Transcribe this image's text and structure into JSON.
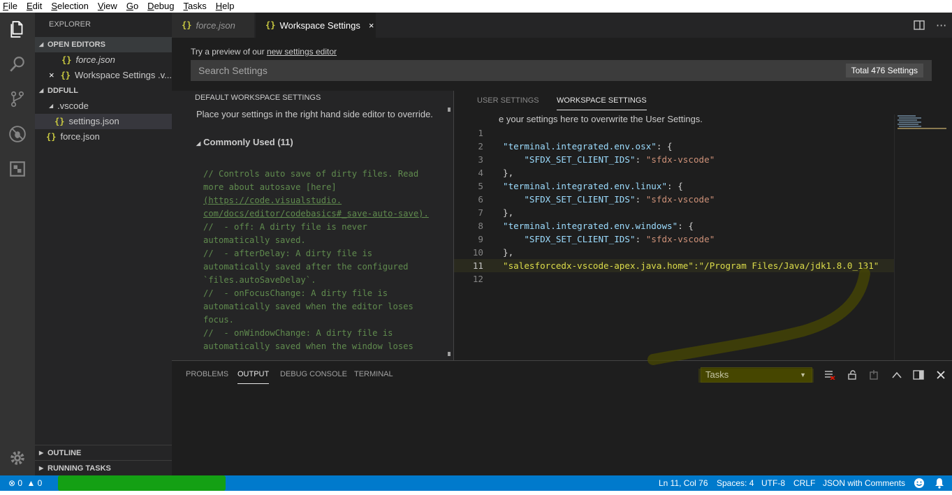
{
  "menu": [
    "File",
    "Edit",
    "Selection",
    "View",
    "Go",
    "Debug",
    "Tasks",
    "Help"
  ],
  "activity": [
    "explorer-icon",
    "search-icon",
    "source-control-icon",
    "debug-icon",
    "extensions-icon",
    "gear-icon"
  ],
  "sidebar": {
    "title": "EXPLORER",
    "open_editors_label": "OPEN EDITORS",
    "open_editors": [
      {
        "name": "force.json",
        "close": ""
      },
      {
        "name": "Workspace Settings .v...",
        "close": "×"
      }
    ],
    "project_label": "DDFULL",
    "folder": ".vscode",
    "settings_file": "settings.json",
    "root_file": "force.json",
    "outline_label": "OUTLINE",
    "running_tasks_label": "RUNNING TASKS"
  },
  "tabs": [
    {
      "label": "force.json",
      "active": false
    },
    {
      "label": "Workspace Settings",
      "active": true,
      "close": "×"
    }
  ],
  "tab_actions": {
    "split": "split-editor-icon",
    "more": "···"
  },
  "settings": {
    "preview_prefix": "Try a preview of our ",
    "preview_link": "new settings editor",
    "search_placeholder": "Search Settings",
    "count": "Total 476 Settings"
  },
  "default_pane": {
    "title": "DEFAULT WORKSPACE SETTINGS",
    "description": "Place your settings in the right hand side editor to override.",
    "group": "Commonly Used (11)",
    "comments": [
      "// Controls auto save of dirty files. Read",
      "more about autosave [here]",
      "(https://code.visualstudio.",
      "com/docs/editor/codebasics#_save-auto-save).",
      "//  - off: A dirty file is never",
      "automatically saved.",
      "//  - afterDelay: A dirty file is",
      "automatically saved after the configured",
      "`files.autoSaveDelay`.",
      "//  - onFocusChange: A dirty file is",
      "automatically saved when the editor loses",
      "focus.",
      "//  - onWindowChange: A dirty file is",
      "automatically saved when the window loses"
    ]
  },
  "workspace_pane": {
    "user_tab": "USER SETTINGS",
    "workspace_tab": "WORKSPACE SETTINGS",
    "description": "e your settings here to overwrite the User Settings.",
    "lines": [
      {
        "n": "1",
        "key": "",
        "rest": ""
      },
      {
        "n": "2",
        "key": "\"terminal.integrated.env.osx\"",
        "rest": ": {"
      },
      {
        "n": "3",
        "key": "    \"SFDX_SET_CLIENT_IDS\"",
        "rest": ": ",
        "val": "\"sfdx-vscode\""
      },
      {
        "n": "4",
        "key": "",
        "rest": "},"
      },
      {
        "n": "5",
        "key": "\"terminal.integrated.env.linux\"",
        "rest": ": {"
      },
      {
        "n": "6",
        "key": "    \"SFDX_SET_CLIENT_IDS\"",
        "rest": ": ",
        "val": "\"sfdx-vscode\""
      },
      {
        "n": "7",
        "key": "",
        "rest": "},"
      },
      {
        "n": "8",
        "key": "\"terminal.integrated.env.windows\"",
        "rest": ": {"
      },
      {
        "n": "9",
        "key": "    \"SFDX_SET_CLIENT_IDS\"",
        "rest": ": ",
        "val": "\"sfdx-vscode\""
      },
      {
        "n": "10",
        "key": "",
        "rest": "},"
      },
      {
        "n": "11",
        "key": "\"salesforcedx-vscode-apex.java.home\"",
        "rest": ":",
        "val": "\"/Program Files/Java/jdk1.8.0_131\""
      },
      {
        "n": "12",
        "key": "",
        "rest": ""
      }
    ]
  },
  "panel": {
    "tabs": [
      "PROBLEMS",
      "OUTPUT",
      "DEBUG CONSOLE",
      "TERMINAL"
    ],
    "active_tab": "OUTPUT",
    "task_select": "Tasks",
    "caret": "▼"
  },
  "status": {
    "errors": "0",
    "warnings": "0",
    "position": "Ln 11, Col 76",
    "spaces": "Spaces: 4",
    "encoding": "UTF-8",
    "eol": "CRLF",
    "language": "JSON with Comments"
  }
}
